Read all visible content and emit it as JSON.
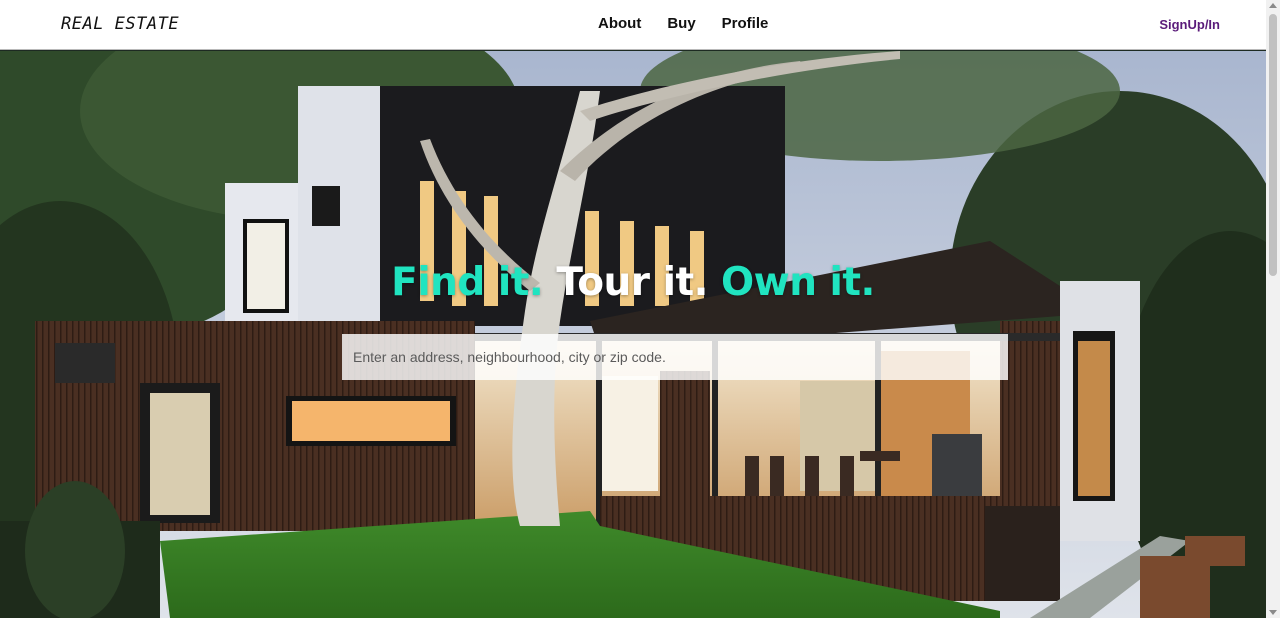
{
  "navbar": {
    "logo": "REAL ESTATE",
    "links": [
      "About",
      "Buy",
      "Profile"
    ],
    "signup_label": "SignUp/In"
  },
  "hero": {
    "tagline": {
      "part1": "Find it.",
      "part2": "Tour it.",
      "part3": "Own it."
    },
    "search_placeholder": "Enter an address, neighbourhood, city or zip code."
  },
  "colors": {
    "accent": "#20e4c0",
    "signup": "#5a1b7a"
  }
}
